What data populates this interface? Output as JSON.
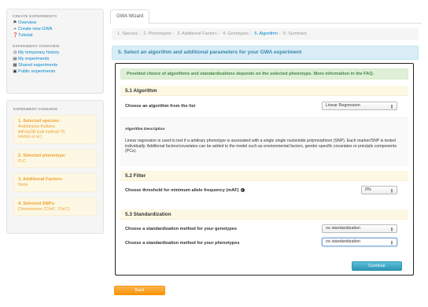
{
  "sidebar": {
    "create_heading": "CREATE EXPERIMENTS",
    "create_items": [
      {
        "icon": "home-icon",
        "label": "Overview"
      },
      {
        "icon": "plus-icon",
        "label": "Create new GWA"
      },
      {
        "icon": "question-icon",
        "label": "Tutorial"
      }
    ],
    "experiment_heading": "EXPERIMENT OVERVIEW",
    "experiment_items": [
      {
        "icon": "clock-icon",
        "label": "My temporary history"
      },
      {
        "icon": "folder-icon",
        "label": "My experiments"
      },
      {
        "icon": "share-icon",
        "label": "Shared experiments"
      },
      {
        "icon": "public-icon",
        "label": "Public experiments"
      }
    ]
  },
  "overview": {
    "heading": "EXPERIMENT OVERVIEW",
    "boxes": [
      {
        "title": "1. Selected species:",
        "lines": [
          "Arabidopsis thaliana",
          "AtPolyDB (call method 75,",
          "Horton et al.)"
        ]
      },
      {
        "title": "2. Selected phenotype:",
        "lines": [
          "FLC"
        ]
      },
      {
        "title": "3. Additional Factors:",
        "lines": [
          "None"
        ]
      },
      {
        "title": "4. Selected SNPs:",
        "lines": [
          "Chromosome ['Chr5', 'Chr1']"
        ]
      }
    ]
  },
  "tabs": {
    "active": "GWA Wizard"
  },
  "breadcrumb": {
    "items": [
      "1. Species",
      "2. Phenotypes",
      "3. Additional Factors",
      "4. Genotypes",
      "5. Algorithm",
      "6. Summary"
    ],
    "separator": "/",
    "active_index": 4
  },
  "step_banner": "5. Select an algorithm and additional parameters for your GWA experiment",
  "info_alert": "Provided choice of algorithms and standardizations depends on the selected phenotype. More information in the FAQ.",
  "algorithm": {
    "heading": "5.1 Algorithm",
    "label": "Choose an algorithm from the list",
    "value": "Linear Regression",
    "desc_title": "Algorithm Description",
    "desc_text": "Linear regression is used to test if a arbitrary phenotype is associated with a single single nucleotide polymorphism (SNP). Each marker/SNP is tested individually. Additional factors/covariates can be added to the model such as environmental factors, gender specific covariates or principle components (PCs)."
  },
  "filter": {
    "heading": "5.2 Filter",
    "label": "Choose threshold for minimum allele frequency (mAF)",
    "value": "0%"
  },
  "standardization": {
    "heading": "5.3 Standardization",
    "genotypes_label": "Choose a standardization method for your genotypes",
    "genotypes_value": "no standardization",
    "phenotypes_label": "Choose a standardization method for your phenotypes",
    "phenotypes_value": "no standardization"
  },
  "buttons": {
    "continue": "Continue",
    "back": "Back"
  },
  "colors": {
    "link": "#0088cc",
    "info": "#3a87ad",
    "warning_text": "#f0a030",
    "continue_btn": "#2f96b4",
    "back_btn": "#f89406"
  }
}
